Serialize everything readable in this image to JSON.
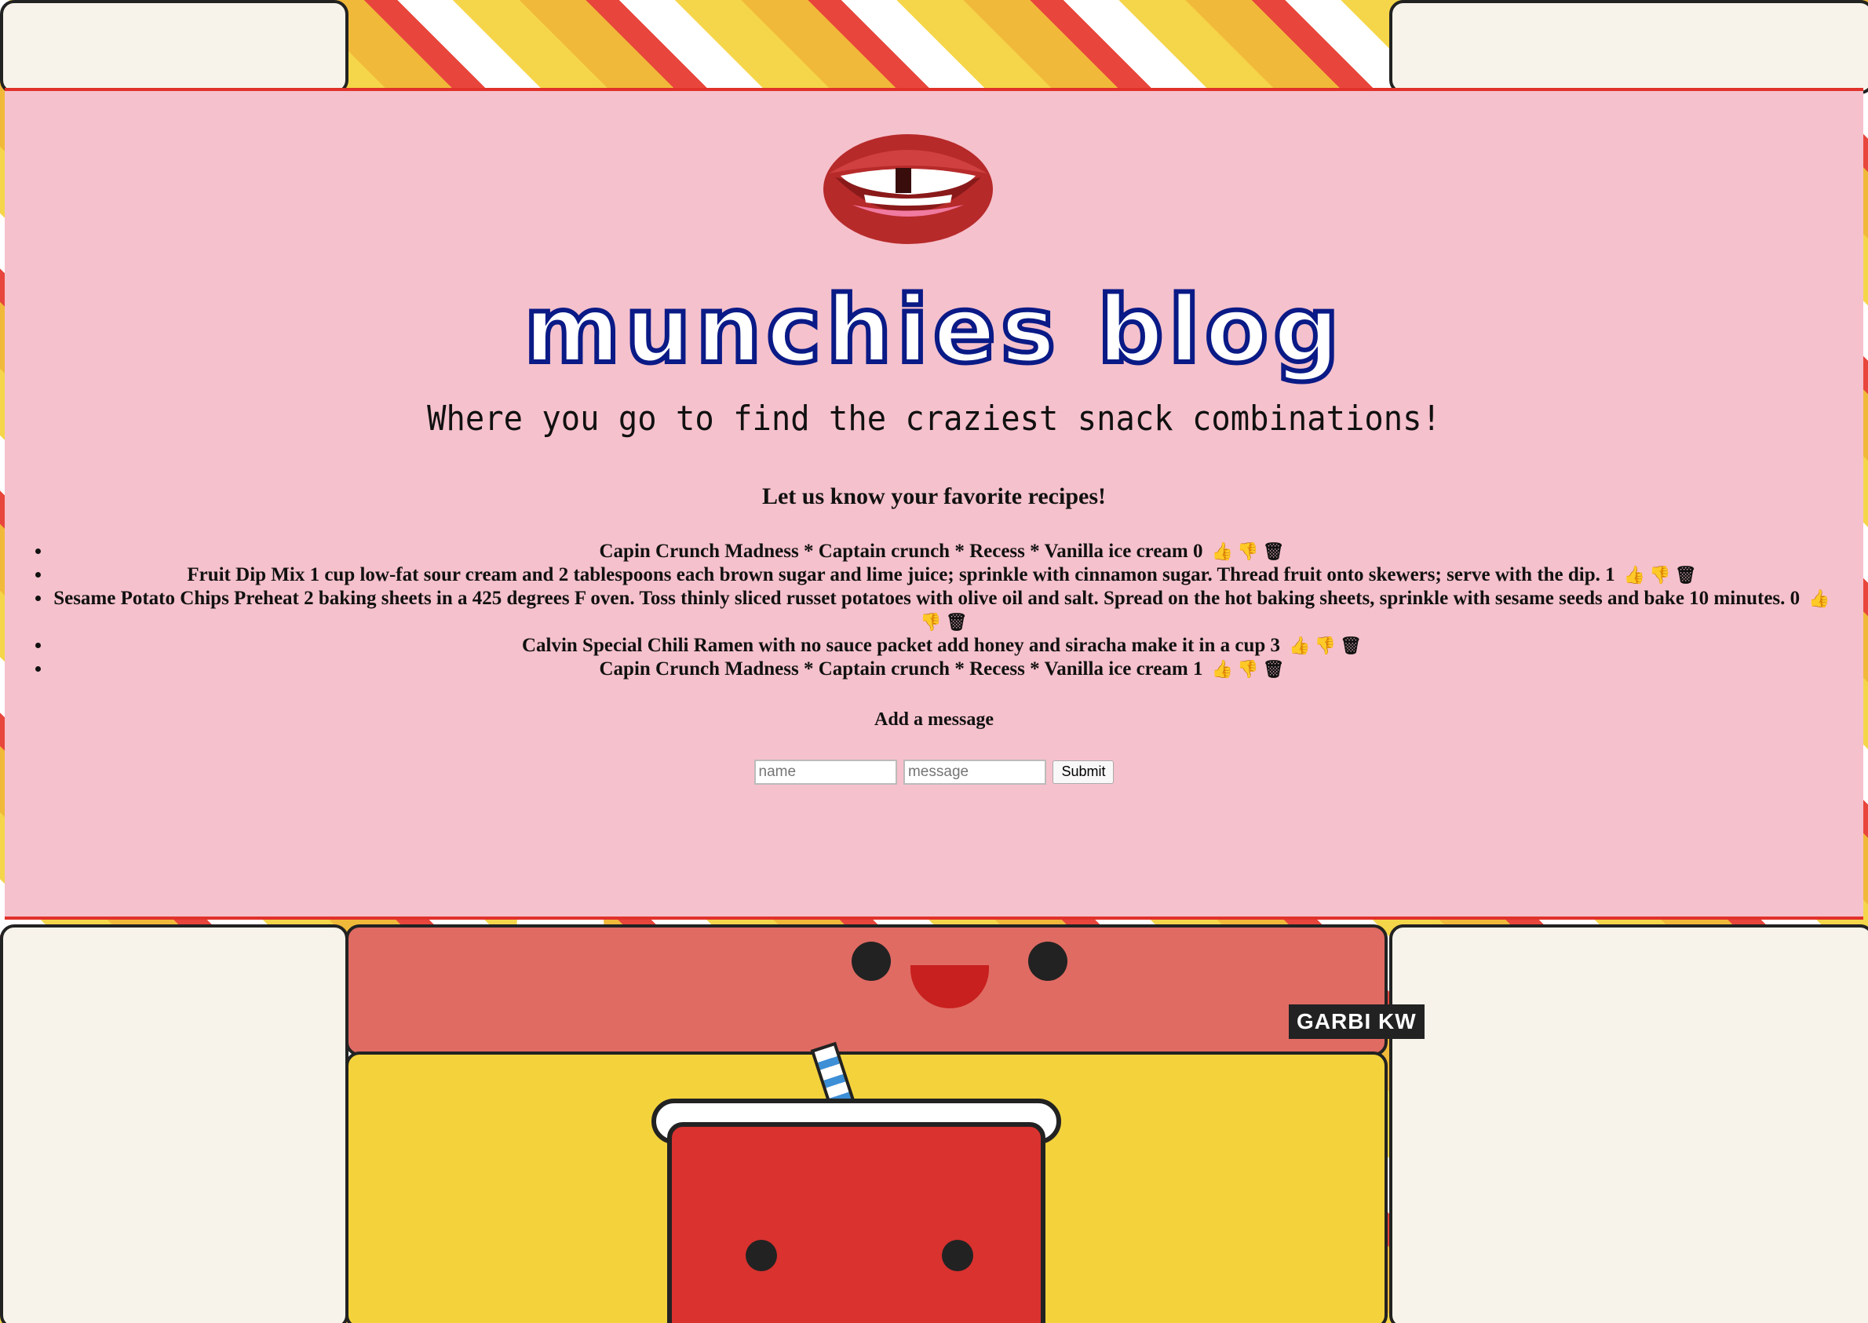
{
  "header": {
    "title": "Munchies Blog",
    "subtitle": "Where you go to find the craziest snack combinations!"
  },
  "recipes_heading": "Let us know your favorite recipes!",
  "recipes": [
    {
      "text": "Capin Crunch Madness * Captain crunch * Recess * Vanilla ice cream",
      "votes": "0"
    },
    {
      "text": "Fruit Dip Mix 1 cup low-fat sour cream and 2 tablespoons each brown sugar and lime juice; sprinkle with cinnamon sugar. Thread fruit onto skewers; serve with the dip.",
      "votes": "1"
    },
    {
      "text": "Sesame Potato Chips Preheat 2 baking sheets in a 425 degrees F oven. Toss thinly sliced russet potatoes with olive oil and salt. Spread on the hot baking sheets, sprinkle with sesame seeds and bake 10 minutes.",
      "votes": "0"
    },
    {
      "text": "Calvin Special Chili Ramen with no sauce packet add honey and siracha make it in a cup",
      "votes": "3"
    },
    {
      "text": "Capin Crunch Madness * Captain crunch * Recess * Vanilla ice cream",
      "votes": "1"
    }
  ],
  "icons": {
    "upvote": "thumbs-up-icon",
    "downvote": "thumbs-down-icon",
    "delete": "trash-icon"
  },
  "form": {
    "heading": "Add a message",
    "name_placeholder": "name",
    "message_placeholder": "message",
    "submit_label": "Submit"
  },
  "watermark": "GARBI KW",
  "colors": {
    "panel": "#f5c1cc",
    "title": "#0a1a86",
    "border": "#e0312a"
  }
}
